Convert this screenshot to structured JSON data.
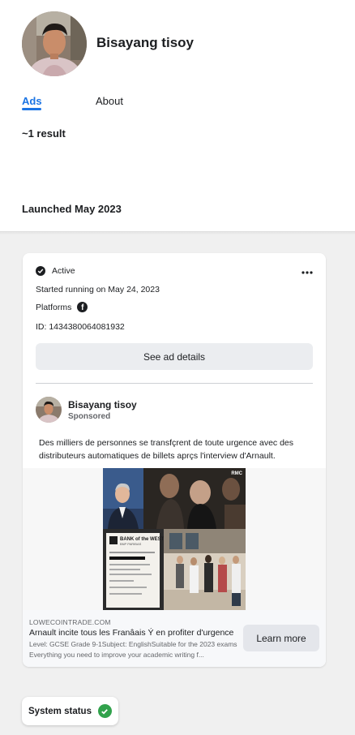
{
  "header": {
    "page_name": "Bisayang tisoy",
    "avatar_icon": "profile-photo"
  },
  "tabs": [
    {
      "label": "Ads",
      "active": true
    },
    {
      "label": "About",
      "active": false
    }
  ],
  "results": {
    "count_text": "~1 result",
    "group_heading": "Launched May 2023"
  },
  "ad_card": {
    "status": "Active",
    "started": "Started running on May 24, 2023",
    "platforms_label": "Platforms",
    "platform_icons": [
      "facebook-icon"
    ],
    "id_text": "ID: 1434380064081932",
    "details_button": "See ad details",
    "advertiser_name": "Bisayang tisoy",
    "sponsored_label": "Sponsored",
    "body_text": "Des milliers de personnes se transfçrent de toute urgence avec des distributeurs automatiques de billets aprçs l'interview d'Arnault.",
    "image": {
      "watermark": "RMC",
      "receipt_bank": "BANK of the WEST",
      "receipt_sub": "BNP PARIBAS"
    },
    "link_domain": "LOWECOINTRADE.COM",
    "link_headline": "Arnault incite tous les Franâais Ý en profiter d'urgence",
    "link_description": "Level: GCSE Grade 9-1Subject: EnglishSuitable for the 2023 exams Everything you need to improve your academic writing f...",
    "cta_button": "Learn more"
  },
  "system_status": {
    "label": "System status",
    "state": "ok"
  },
  "colors": {
    "accent": "#1b74e4",
    "background": "#f0f0f0",
    "ok_green": "#31a24c"
  }
}
